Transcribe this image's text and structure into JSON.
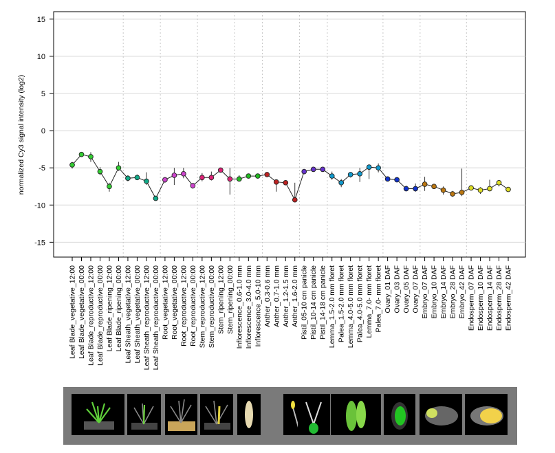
{
  "chart_data": {
    "type": "line",
    "ylabel": "normalized Cy3 signal intensity (log2)",
    "ylim": [
      -17,
      16
    ],
    "yticks": [
      -15,
      -10,
      -5,
      0,
      5,
      10,
      15
    ],
    "grid": true,
    "categories": [
      "Leaf Blade_vegetative_12:00",
      "Leaf Blade_vegetative_00:00",
      "Leaf Blade_reproductive_12:00",
      "Leaf Blade_reproductive_00:00",
      "Leaf Blade_ripening_12:00",
      "Leaf Blade_ripening_00:00",
      "Leaf Sheath_vegetative_12:00",
      "Leaf Sheath_vegetative_00:00",
      "Leaf Sheath_reproductive_12:00",
      "Leaf Sheath_reproductive_00:00",
      "Root_vegetative_12:00",
      "Root_vegetative_00:00",
      "Root_reproductive_12:00",
      "Root_reproductive_00:00",
      "Stem_reproductive_12:00",
      "Stem_reproductive_00:00",
      "Stem_ripening_12:00",
      "Stem_ripening_00:00",
      "Inflorescence_0.6-1.0 mm",
      "Inflorescence_3.0-4.0 mm",
      "Inflorescence_5.0-10 mm",
      "Anther_0.3-0.6 mm",
      "Anther_0.7-1.0 mm",
      "Anther_1.2-1.5 mm",
      "Anther_1.6-2.0 mm",
      "Pistil_05-10 cm panicle",
      "Pistil_10-14 cm panicle",
      "Pistil_14-18 cm panicle",
      "Lemma_1.5-2.0 mm floret",
      "Palea_1.5-2.0 mm floret",
      "Lemma_4.0-5.0 mm floret",
      "Palea_4.0-5.0 mm floret",
      "Lemma_7.0- mm floret",
      "Palea_7.0- mm floret",
      "Ovary_01 DAF",
      "Ovary_03 DAF",
      "Ovary_05 DAF",
      "Ovary_07 DAF",
      "Embryo_07 DAF",
      "Embryo_10 DAF",
      "Embryo_14 DAF",
      "Embryo_28 DAF",
      "Embryo_42 DAF",
      "Endosperm_07 DAF",
      "Endosperm_10 DAF",
      "Endosperm_14 DAF",
      "Endosperm_28 DAF",
      "Endosperm_42 DAF"
    ],
    "values": [
      -4.6,
      -3.2,
      -3.5,
      -5.5,
      -7.5,
      -5.0,
      -6.4,
      -6.3,
      -6.8,
      -9.1,
      -6.6,
      -6.0,
      -5.8,
      -7.4,
      -6.3,
      -6.3,
      -5.3,
      -6.5,
      -6.5,
      -6.1,
      -6.1,
      -5.9,
      -6.9,
      -7.0,
      -9.3,
      -5.5,
      -5.2,
      -5.2,
      -6.1,
      -7.0,
      -5.9,
      -5.8,
      -4.9,
      -5.0,
      -6.5,
      -6.6,
      -7.8,
      -7.8,
      -7.2,
      -7.5,
      -8.0,
      -8.5,
      -8.3,
      -7.7,
      -8.0,
      -7.8,
      -7.0,
      -7.9
    ],
    "err_high": [
      -4.2,
      -3.0,
      -2.9,
      -4.9,
      -7.0,
      -4.2,
      -6.0,
      -5.9,
      -5.6,
      -8.8,
      -6.3,
      -5.0,
      -5.0,
      -7.1,
      -5.7,
      -5.5,
      -5.2,
      -5.0,
      -6.0,
      -6.0,
      -5.9,
      -5.7,
      -6.7,
      -6.8,
      -7.0,
      -5.3,
      -5.0,
      -5.0,
      -5.5,
      -6.5,
      -5.6,
      -5.0,
      -4.7,
      -4.4,
      -6.4,
      -6.4,
      -7.4,
      -7.1,
      -6.2,
      -7.2,
      -7.5,
      -8.1,
      -5.1,
      -7.4,
      -7.6,
      -6.6,
      -6.8,
      -7.7
    ],
    "err_low": [
      -5.1,
      -3.4,
      -4.2,
      -6.0,
      -8.2,
      -5.4,
      -6.8,
      -6.6,
      -7.3,
      -9.4,
      -7.0,
      -7.3,
      -6.4,
      -7.8,
      -6.8,
      -6.7,
      -5.4,
      -8.6,
      -6.8,
      -6.2,
      -6.3,
      -6.1,
      -8.2,
      -7.2,
      -9.6,
      -5.7,
      -5.4,
      -5.4,
      -6.6,
      -7.6,
      -6.3,
      -6.9,
      -6.5,
      -5.6,
      -6.6,
      -6.8,
      -8.1,
      -8.2,
      -8.1,
      -7.8,
      -8.6,
      -8.9,
      -8.8,
      -7.9,
      -8.5,
      -8.0,
      -7.5,
      -8.1
    ],
    "point_colors": [
      "#33cc33",
      "#33cc33",
      "#33cc33",
      "#33cc33",
      "#33cc33",
      "#33cc33",
      "#11aa88",
      "#11aa88",
      "#11aa88",
      "#11aa88",
      "#cc44cc",
      "#cc44cc",
      "#cc44cc",
      "#cc44cc",
      "#dd2277",
      "#dd2277",
      "#dd2277",
      "#dd2277",
      "#22bb22",
      "#22bb22",
      "#22bb22",
      "#bb2222",
      "#bb2222",
      "#bb2222",
      "#bb2222",
      "#6633cc",
      "#6633cc",
      "#6633cc",
      "#1199cc",
      "#1199cc",
      "#1199cc",
      "#1199cc",
      "#1199cc",
      "#1199cc",
      "#1133cc",
      "#1133cc",
      "#1133cc",
      "#1133cc",
      "#bb7711",
      "#bb7711",
      "#bb7711",
      "#bb7711",
      "#bb7711",
      "#dddd22",
      "#dddd22",
      "#dddd22",
      "#dddd22",
      "#dddd22"
    ],
    "group_separators_after": [
      5,
      9,
      13,
      17,
      20,
      24,
      27,
      33,
      37,
      42
    ]
  },
  "strip": {
    "background": "#7a7a7a",
    "thumbnails": [
      {
        "name": "vegetative-plant"
      },
      {
        "name": "reproductive-plant"
      },
      {
        "name": "ripening-plant-soil"
      },
      {
        "name": "ripening-plant-panicle"
      },
      {
        "name": "inflorescence"
      },
      {
        "name": "floret-anthers"
      },
      {
        "name": "pistil"
      },
      {
        "name": "lemma-palea"
      },
      {
        "name": "ovary"
      },
      {
        "name": "embryo-seed"
      },
      {
        "name": "endosperm-seed"
      }
    ]
  }
}
